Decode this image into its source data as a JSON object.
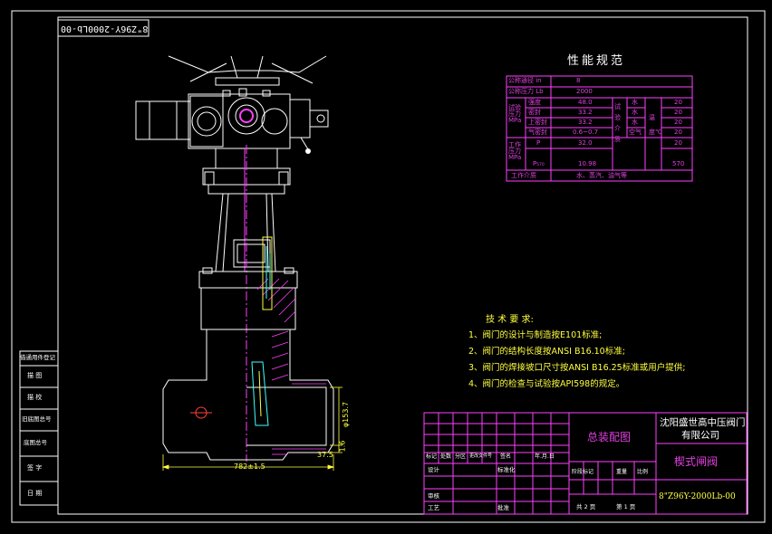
{
  "drawing": {
    "rev_code": "8\"Z96Y-2000Lb-00",
    "perf_title": "性能规范",
    "perf_table": {
      "rows": [
        {
          "label": "公称通径 in",
          "value": "8"
        },
        {
          "label": "公称压力 Lb",
          "value": "2000"
        }
      ],
      "test_label": "试验压力MPa",
      "test_rows": [
        {
          "label": "强度",
          "value": "48.0"
        },
        {
          "label": "密封",
          "value": "33.2"
        },
        {
          "label": "上密封",
          "value": "33.2"
        },
        {
          "label": "气密封",
          "value": "0.6~0.7"
        }
      ],
      "test_medium_label": "试验介质",
      "test_medium": [
        "水",
        "水",
        "水",
        "空气"
      ],
      "temp_label": "温度℃",
      "temps": [
        "20",
        "20",
        "20",
        "20",
        "20",
        "570"
      ],
      "work_label": "工作压力MPa",
      "work_rows": [
        {
          "label": "P",
          "value": "32.0"
        },
        {
          "label": "P₅₇₀",
          "value": "10.98"
        }
      ],
      "medium_label": "工作介质",
      "medium_value": "水、蒸汽、油气等"
    },
    "tech_title": "技 术 要 求:",
    "tech_reqs": [
      "1、阀门的设计与制造按E101标准;",
      "2、阀门的结构长度按ANSI B16.10标准;",
      "3、阀门的焊接坡口尺寸按ANSI B16.25标准或用户提供;",
      "4、阀门的检查与试验按API598的规定。"
    ],
    "dims": {
      "length": "782±1.5",
      "bore": "φ153.7",
      "d1": "1.6",
      "d2": "37.5"
    },
    "side_table": [
      "借通用件登记",
      "描  图",
      "描  校",
      "旧底图总号",
      "底图总号",
      "签  字",
      "日  期"
    ],
    "title_block": {
      "assembly": "总装配图",
      "company_line1": "沈阳盛世高中压阀门",
      "company_line2": "有限公司",
      "product": "楔式闸阀",
      "drawing_no": "8\"Z96Y-2000Lb-00",
      "header_labels": [
        "标记",
        "处数",
        "分区",
        "更改文件号",
        "签名",
        "年.月.日"
      ],
      "row_labels": [
        "设计",
        "标准化",
        "审核",
        "工艺",
        "批准"
      ],
      "stage_labels": [
        "阶段标记",
        "重量",
        "比例"
      ],
      "sheet": "共 2 页",
      "page": "第 1 页"
    }
  }
}
